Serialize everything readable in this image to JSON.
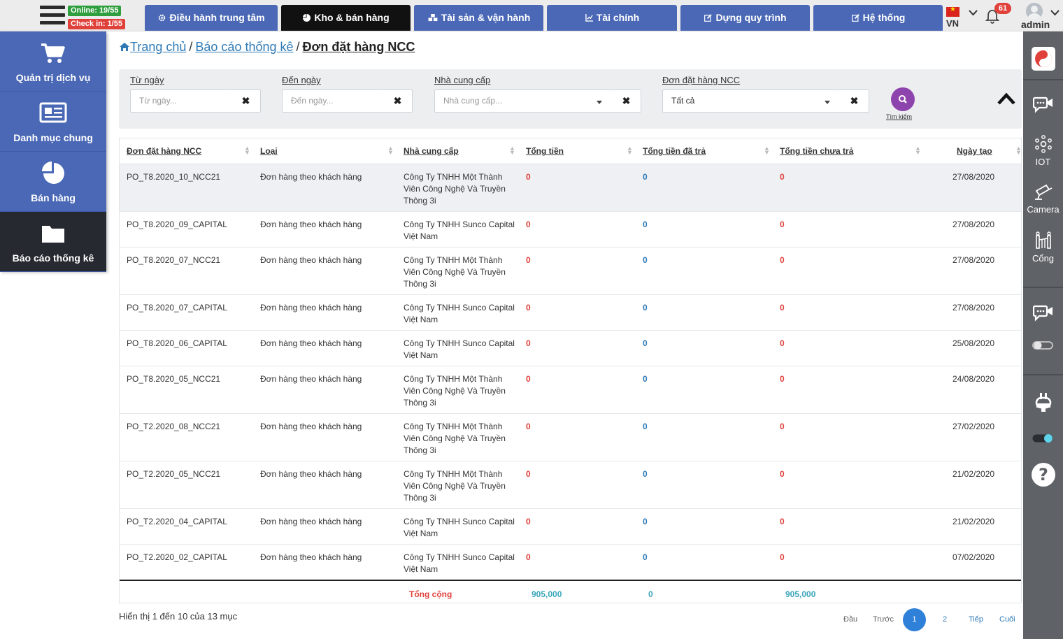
{
  "topbar": {
    "online": "Online: 19/55",
    "checkin": "Check in: 1/55",
    "tabs": [
      {
        "label": "Điều hành trung tâm",
        "icon": "gear-icon"
      },
      {
        "label": "Kho & bán hàng",
        "icon": "pie-chart-icon"
      },
      {
        "label": "Tài sản & vận hành",
        "icon": "cubes-icon"
      },
      {
        "label": "Tài chính",
        "icon": "line-chart-icon"
      },
      {
        "label": "Dựng quy trình",
        "icon": "edit-icon"
      },
      {
        "label": "Hệ thống",
        "icon": "edit-icon"
      }
    ],
    "lang": "VN",
    "notifications": "61",
    "user": "admin"
  },
  "sidebar": {
    "items": [
      {
        "label": "Quản trị dịch vụ",
        "icon": "shopping-cart-icon"
      },
      {
        "label": "Danh mục chung",
        "icon": "newspaper-icon"
      },
      {
        "label": "Bán hàng",
        "icon": "pie-chart-icon"
      },
      {
        "label": "Báo cáo thống kê",
        "icon": "folder-icon"
      }
    ]
  },
  "rightbar": {
    "iot": "IOT",
    "camera": "Camera",
    "gate": "Cổng"
  },
  "breadcrumb": {
    "home": "Trang chủ",
    "reports": "Báo cáo thống kê",
    "current": "Đơn đặt hàng NCC"
  },
  "filters": {
    "from_label": "Từ ngày",
    "from_placeholder": "Từ ngày...",
    "to_label": "Đến ngày",
    "to_placeholder": "Đến ngày...",
    "supplier_label": "Nhà cung cấp",
    "supplier_placeholder": "Nhà cung cấp...",
    "order_label": "Đơn đặt hàng NCC",
    "order_value": "Tất cả",
    "search_label": "Tìm kiếm"
  },
  "table": {
    "headers": [
      "Đơn đặt hàng NCC",
      "Loại",
      "Nhà cung cấp",
      "Tổng tiền",
      "Tổng tiền đã trả",
      "Tổng tiền chưa trả",
      "Ngày tạo"
    ],
    "rows": [
      {
        "code": "PO_T8.2020_10_NCC21",
        "type": "Đơn hàng theo khách hàng",
        "supplier": "Công Ty TNHH Một Thành Viên Công Nghệ Và Truyền Thông 3i",
        "total": "0",
        "paid": "0",
        "unpaid": "0",
        "date": "27/08/2020"
      },
      {
        "code": "PO_T8.2020_09_CAPITAL",
        "type": "Đơn hàng theo khách hàng",
        "supplier": "Công Ty TNHH Sunco Capital Việt Nam",
        "total": "0",
        "paid": "0",
        "unpaid": "0",
        "date": "27/08/2020"
      },
      {
        "code": "PO_T8.2020_07_NCC21",
        "type": "Đơn hàng theo khách hàng",
        "supplier": "Công Ty TNHH Một Thành Viên Công Nghệ Và Truyền Thông 3i",
        "total": "0",
        "paid": "0",
        "unpaid": "0",
        "date": "27/08/2020"
      },
      {
        "code": "PO_T8.2020_07_CAPITAL",
        "type": "Đơn hàng theo khách hàng",
        "supplier": "Công Ty TNHH Sunco Capital Việt Nam",
        "total": "0",
        "paid": "0",
        "unpaid": "0",
        "date": "27/08/2020"
      },
      {
        "code": "PO_T8.2020_06_CAPITAL",
        "type": "Đơn hàng theo khách hàng",
        "supplier": "Công Ty TNHH Sunco Capital Việt Nam",
        "total": "0",
        "paid": "0",
        "unpaid": "0",
        "date": "25/08/2020"
      },
      {
        "code": "PO_T8.2020_05_NCC21",
        "type": "Đơn hàng theo khách hàng",
        "supplier": "Công Ty TNHH Một Thành Viên Công Nghệ Và Truyền Thông 3i",
        "total": "0",
        "paid": "0",
        "unpaid": "0",
        "date": "24/08/2020"
      },
      {
        "code": "PO_T2.2020_08_NCC21",
        "type": "Đơn hàng theo khách hàng",
        "supplier": "Công Ty TNHH Một Thành Viên Công Nghệ Và Truyền Thông 3i",
        "total": "0",
        "paid": "0",
        "unpaid": "0",
        "date": "27/02/2020"
      },
      {
        "code": "PO_T2.2020_05_NCC21",
        "type": "Đơn hàng theo khách hàng",
        "supplier": "Công Ty TNHH Một Thành Viên Công Nghệ Và Truyền Thông 3i",
        "total": "0",
        "paid": "0",
        "unpaid": "0",
        "date": "21/02/2020"
      },
      {
        "code": "PO_T2.2020_04_CAPITAL",
        "type": "Đơn hàng theo khách hàng",
        "supplier": "Công Ty TNHH Sunco Capital Việt Nam",
        "total": "0",
        "paid": "0",
        "unpaid": "0",
        "date": "21/02/2020"
      },
      {
        "code": "PO_T2.2020_02_CAPITAL",
        "type": "Đơn hàng theo khách hàng",
        "supplier": "Công Ty TNHH Sunco Capital Việt Nam",
        "total": "0",
        "paid": "0",
        "unpaid": "0",
        "date": "07/02/2020"
      }
    ],
    "footer": {
      "label": "Tổng cộng",
      "total": "905,000",
      "paid": "0",
      "unpaid": "905,000"
    }
  },
  "pagination": {
    "info": "Hiển thị 1 đến 10 của 13 mục",
    "first": "Đầu",
    "prev": "Trước",
    "current": "1",
    "page2": "2",
    "next": "Tiếp",
    "last": "Cuối"
  },
  "colors": {
    "nav": "#4a68b5",
    "active": "#111111",
    "red": "#e0413b",
    "blue": "#2f7ab6",
    "search": "#8e44ad"
  }
}
